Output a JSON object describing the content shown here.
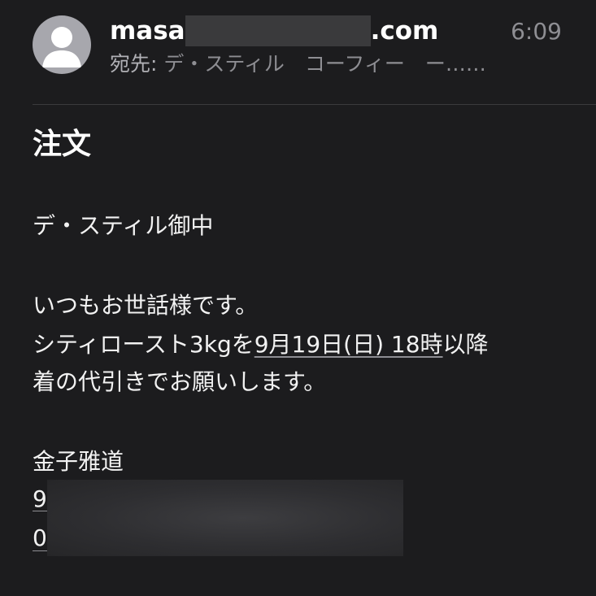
{
  "header": {
    "sender_prefix": "masa",
    "sender_suffix": ".com",
    "time": "6:09",
    "recipients_label": "宛先:",
    "recipients_value": "デ・スティル　コーフィー　ー……"
  },
  "email": {
    "subject": "注文",
    "salutation": "デ・スティル御中",
    "greeting": "いつもお世話様です。",
    "order_prefix": "シティロースト3kgを",
    "order_date": "9月19日(日) 18時",
    "order_suffix": "以降",
    "order_line2": "着の代引きでお願いします。",
    "signature_name": "金子雅道",
    "signature_line1_start": "9",
    "signature_line2_start": "0"
  },
  "colors": {
    "background": "#1c1c1e",
    "secondary_text": "#8e8e93",
    "avatar": "#a7a7ad"
  },
  "icons": {
    "avatar": "person-silhouette-icon"
  }
}
